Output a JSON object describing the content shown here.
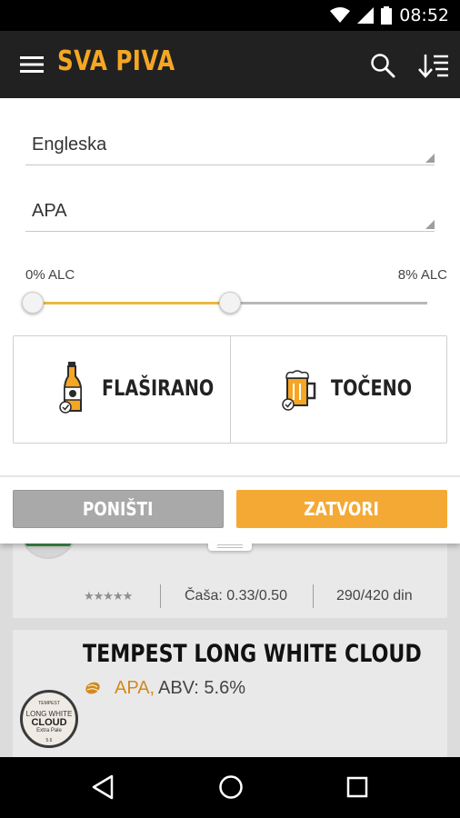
{
  "status_bar": {
    "time": "08:52",
    "icons": [
      "wifi-icon",
      "signal-icon",
      "battery-icon"
    ]
  },
  "app_bar": {
    "title": "SVA PIVA",
    "icons": [
      "menu-icon",
      "search-icon",
      "sort-icon"
    ]
  },
  "filter": {
    "country_value": "Engleska",
    "style_value": "APA",
    "alc_min_label": "0% ALC",
    "alc_max_label": "8% ALC",
    "alc_range_fraction": [
      0.0,
      0.5
    ],
    "types": [
      {
        "label": "FLAŠIRANO",
        "icon": "bottle-check-icon"
      },
      {
        "label": "TOČENO",
        "icon": "beer-mug-check-icon"
      }
    ],
    "reset_label": "PONIŠTI",
    "close_label": "ZATVORI"
  },
  "list": {
    "item1": {
      "rating_stars": "★★★★★",
      "glass": "Čaša: 0.33/0.50",
      "price": "290/420 din"
    },
    "item2": {
      "name": "TEMPEST LONG WHITE CLOUD",
      "style": "APA,",
      "abv": "ABV: 5.6%",
      "icon": "hop-icon",
      "logo_text": [
        "TEMPEST",
        "LONG WHITE",
        "CLOUD",
        "Extra Pale",
        "5.6"
      ]
    }
  },
  "nav_bar": {
    "icons": [
      "back-icon",
      "home-icon",
      "recent-apps-icon"
    ]
  },
  "colors": {
    "accent": "#f5a623",
    "appbar": "#212121",
    "slider_fill": "#e8b93b",
    "style_text": "#d18a1e"
  }
}
